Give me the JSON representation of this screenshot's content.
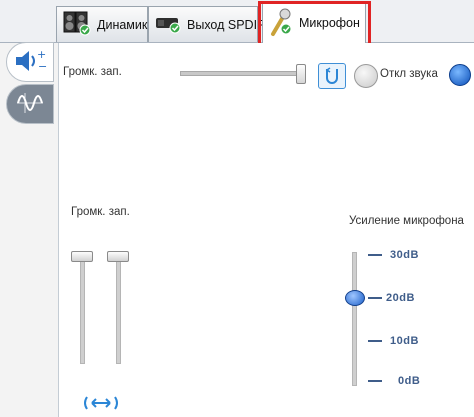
{
  "tabs": [
    {
      "label": "Динамик",
      "icon": "speaker-icon"
    },
    {
      "label": "Выход SPDIF",
      "icon": "spdif-device-icon"
    },
    {
      "label": "Микрофон",
      "icon": "microphone-icon"
    }
  ],
  "recording": {
    "volume_label": "Громк. зап.",
    "mute_label": "Откл звука",
    "channels_label": "Громк. зап."
  },
  "boost": {
    "title": "Усиление микрофона",
    "levels": [
      "30dB",
      "20dB",
      "10dB",
      "0dB"
    ],
    "selected": "20dB"
  },
  "colors": {
    "highlight": "#e02424",
    "accent": "#3f5d8a"
  }
}
